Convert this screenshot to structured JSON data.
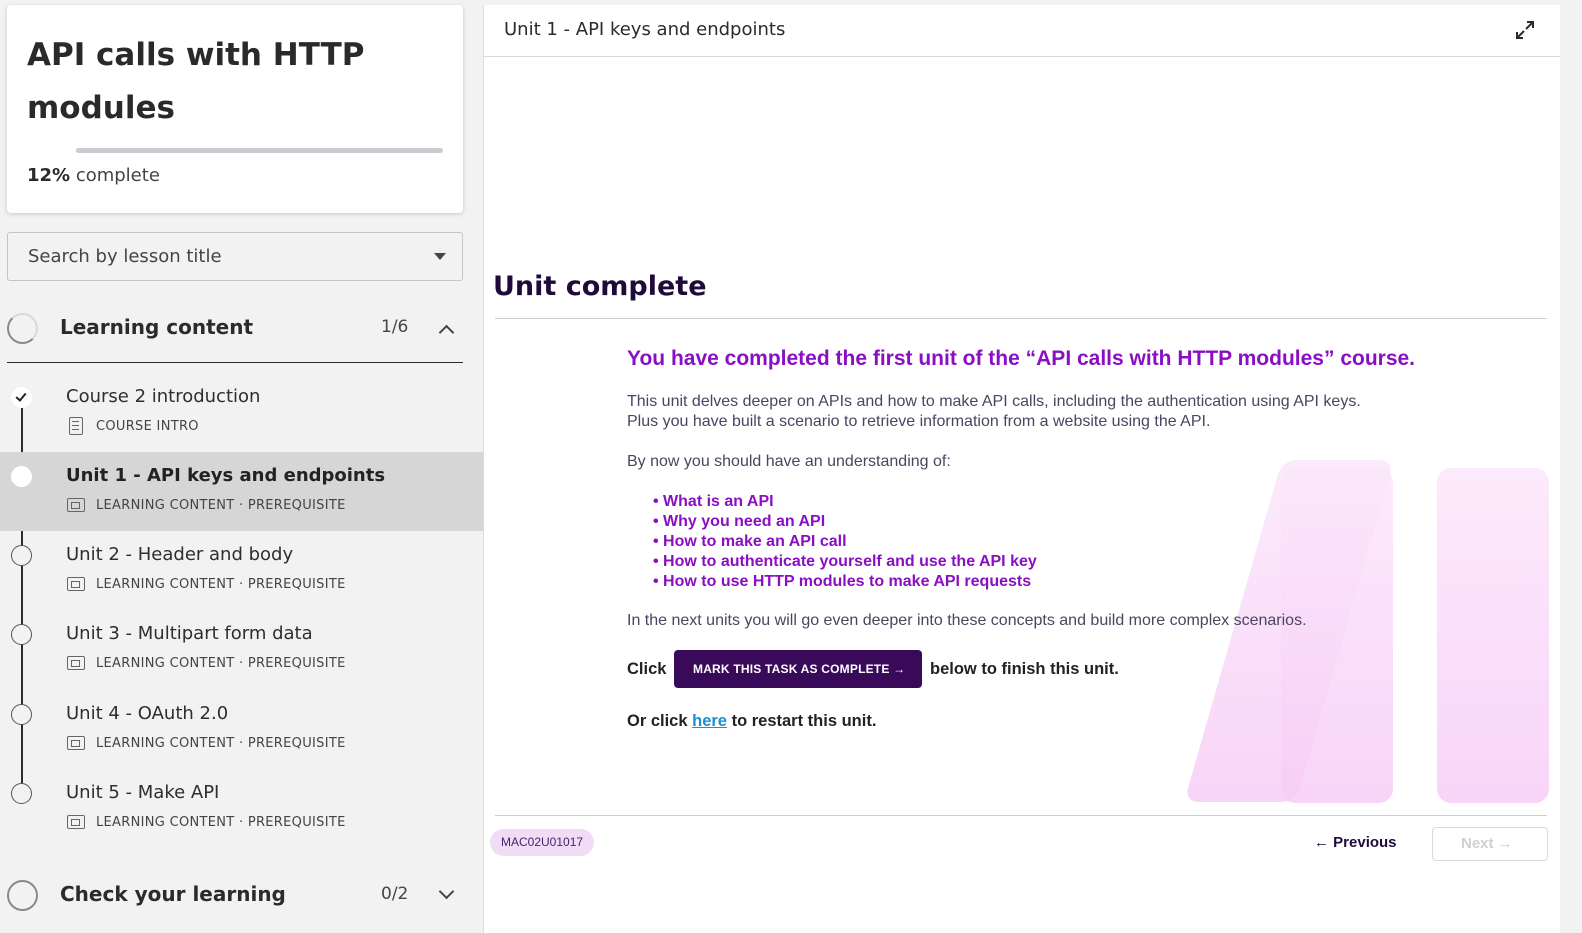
{
  "sidebar": {
    "course_title": "API calls with HTTP modules",
    "progress_percent": 12,
    "progress_value": "12%",
    "progress_suffix": " complete",
    "search": {
      "placeholder": "Search by lesson title"
    },
    "sections": [
      {
        "title": "Learning content",
        "count": "1/6",
        "expanded": true
      },
      {
        "title": "Check your learning",
        "count": "0/2",
        "expanded": false
      }
    ],
    "lessons": [
      {
        "title": "Course 2 introduction",
        "meta": "COURSE INTRO",
        "status": "complete",
        "icon": "document-icon"
      },
      {
        "title": "Unit 1 - API keys and endpoints",
        "meta": "LEARNING CONTENT · PREREQUISITE",
        "status": "active",
        "icon": "slides-icon"
      },
      {
        "title": "Unit 2 - Header and body",
        "meta": "LEARNING CONTENT · PREREQUISITE",
        "status": "incomplete",
        "icon": "slides-icon"
      },
      {
        "title": "Unit 3 - Multipart form data",
        "meta": "LEARNING CONTENT · PREREQUISITE",
        "status": "incomplete",
        "icon": "slides-icon"
      },
      {
        "title": "Unit 4 - OAuth 2.0",
        "meta": "LEARNING CONTENT · PREREQUISITE",
        "status": "incomplete",
        "icon": "slides-icon"
      },
      {
        "title": "Unit 5 - Make API",
        "meta": "LEARNING CONTENT · PREREQUISITE",
        "status": "incomplete",
        "icon": "slides-icon"
      }
    ]
  },
  "main": {
    "header_title": "Unit 1 - API keys and endpoints",
    "unit_complete_heading": "Unit complete",
    "headline": "You have completed the first unit of the “API calls with HTTP modules” course.",
    "intro_line1": "This unit delves deeper on APIs and how to make API calls, including the authentication using API keys.",
    "intro_line2": "Plus you have built a scenario to retrieve information from a website using the API.",
    "understanding_lead": "By now you should have an understanding of:",
    "bullets": [
      "What is an API",
      "Why you need an API",
      "How to make an API call",
      "How to authenticate yourself and use the API key",
      "How to use HTTP modules to make API requests"
    ],
    "next_units": "In the next units you will go even deeper into these concepts and build more complex scenarios.",
    "click_word": "Click",
    "mark_complete_label": "MARK THIS TASK AS COMPLETE",
    "below_text": "below to finish this unit.",
    "restart_prefix": "Or click ",
    "restart_link": "here",
    "restart_suffix": " to restart this unit.",
    "unit_code": "MAC02U01017",
    "previous_label": "← Previous",
    "next_label": "Next →"
  },
  "colors": {
    "accent_purple": "#8a0fc4",
    "button_dark": "#3a0a5a",
    "link_blue": "#1b8fd3",
    "active_row": "#d6d6d6"
  }
}
